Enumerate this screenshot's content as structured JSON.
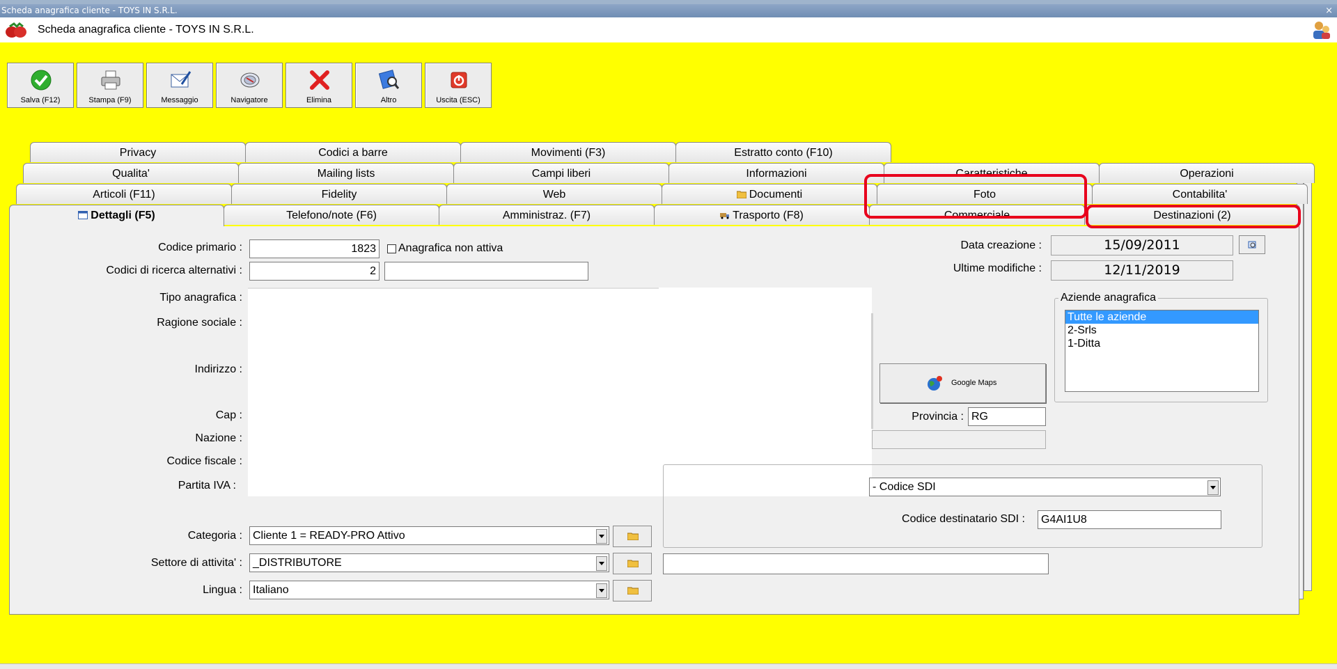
{
  "window": {
    "title": "Scheda anagrafica cliente - TOYS IN S.R.L.",
    "close": "×",
    "header_title": "Scheda anagrafica cliente - TOYS IN S.R.L."
  },
  "toolbar": [
    {
      "label": "Salva (F12)",
      "icon": "check-icon"
    },
    {
      "label": "Stampa (F9)",
      "icon": "printer-icon"
    },
    {
      "label": "Messaggio",
      "icon": "message-icon"
    },
    {
      "label": "Navigatore",
      "icon": "navigator-icon"
    },
    {
      "label": "Elimina",
      "icon": "delete-icon"
    },
    {
      "label": "Altro",
      "icon": "other-icon"
    },
    {
      "label": "Uscita (ESC)",
      "icon": "exit-icon"
    }
  ],
  "tabs": {
    "row1": [
      "Privacy",
      "Codici a barre",
      "Movimenti (F3)",
      "Estratto conto (F10)"
    ],
    "row2": [
      "Qualita'",
      "Mailing lists",
      "Campi liberi",
      "Informazioni",
      "Caratteristiche",
      "Operazioni"
    ],
    "row3": [
      "Articoli (F11)",
      "Fidelity",
      "Web",
      "Documenti",
      "Foto",
      "Contabilita'"
    ],
    "row4": [
      "Dettagli (F5)",
      "Telefono/note (F6)",
      "Amministraz. (F7)",
      "Trasporto (F8)",
      "Commerciale",
      "Destinazioni (2)"
    ]
  },
  "form": {
    "codice_primario_label": "Codice primario :",
    "codice_primario": "1823",
    "anagrafica_non_attiva": "Anagrafica non attiva",
    "codici_ricerca_label": "Codici di ricerca alternativi :",
    "codici_ricerca_1": "2",
    "codici_ricerca_2": "",
    "tipo_anagrafica_label": "Tipo anagrafica :",
    "ragione_sociale_label": "Ragione sociale :",
    "indirizzo_label": "Indirizzo :",
    "cap_label": "Cap :",
    "nazione_label": "Nazione :",
    "codice_fiscale_label": "Codice fiscale :",
    "partita_iva_label": "Partita IVA :",
    "data_creazione_label": "Data creazione :",
    "data_creazione": "15/09/2011",
    "ultime_modifiche_label": "Ultime modifiche :",
    "ultime_modifiche": "12/11/2019",
    "aziende_label": "Aziende anagrafica",
    "aziende": [
      "Tutte le aziende",
      "2-Srls",
      "1-Ditta"
    ],
    "google_maps": "Google Maps",
    "provincia_label": "Provincia :",
    "provincia": "RG",
    "sdi_select": "- Codice SDI",
    "codice_sdi_label": "Codice destinatario SDI :",
    "codice_sdi": "G4AI1U8",
    "categoria_label": "Categoria :",
    "categoria": "Cliente 1 = READY-PRO Attivo",
    "settore_label": "Settore di attivita' :",
    "settore": "_DISTRIBUTORE",
    "settore_extra": "",
    "lingua_label": "Lingua :",
    "lingua": "Italiano"
  },
  "colors": {
    "background": "#ffff00",
    "highlight": "#e8001c",
    "selection": "#3399ff"
  }
}
